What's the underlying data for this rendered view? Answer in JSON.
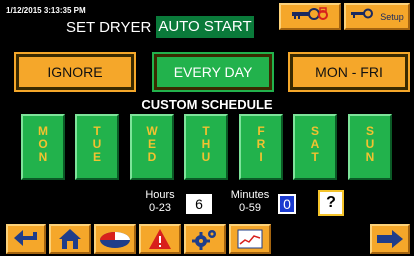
{
  "header": {
    "timestamp": "1/12/2015 3:13:35 PM",
    "title": "SET DRYER",
    "status": "AUTO START",
    "setup_label": "Setup"
  },
  "modes": {
    "ignore": "IGNORE",
    "every_day": "EVERY DAY",
    "mon_fri": "MON - FRI",
    "selected": "EVERY DAY"
  },
  "custom_schedule": {
    "label": "CUSTOM SCHEDULE",
    "days": [
      "M\nO\nN",
      "T\nU\nE",
      "W\nE\nD",
      "T\nH\nU",
      "F\nR\nI",
      "S\nA\nT",
      "S\nU\nN"
    ]
  },
  "time": {
    "hours_label": "Hours",
    "hours_range": "0-23",
    "hours_value": "6",
    "minutes_label": "Minutes",
    "minutes_range": "0-59",
    "minutes_value": "0",
    "help": "?"
  },
  "toolbar": {
    "icons": [
      "back-arrow-icon",
      "home-icon",
      "pie-chart-icon",
      "alarm-warning-icon",
      "gears-icon",
      "trend-chart-icon",
      "forward-arrow-icon"
    ]
  },
  "colors": {
    "accent_orange": "#f5a72a",
    "active_green": "#22b24c",
    "status_green": "#0a7a3a",
    "day_text_yellow": "#f2c230",
    "alarm_red": "#d8201c"
  }
}
